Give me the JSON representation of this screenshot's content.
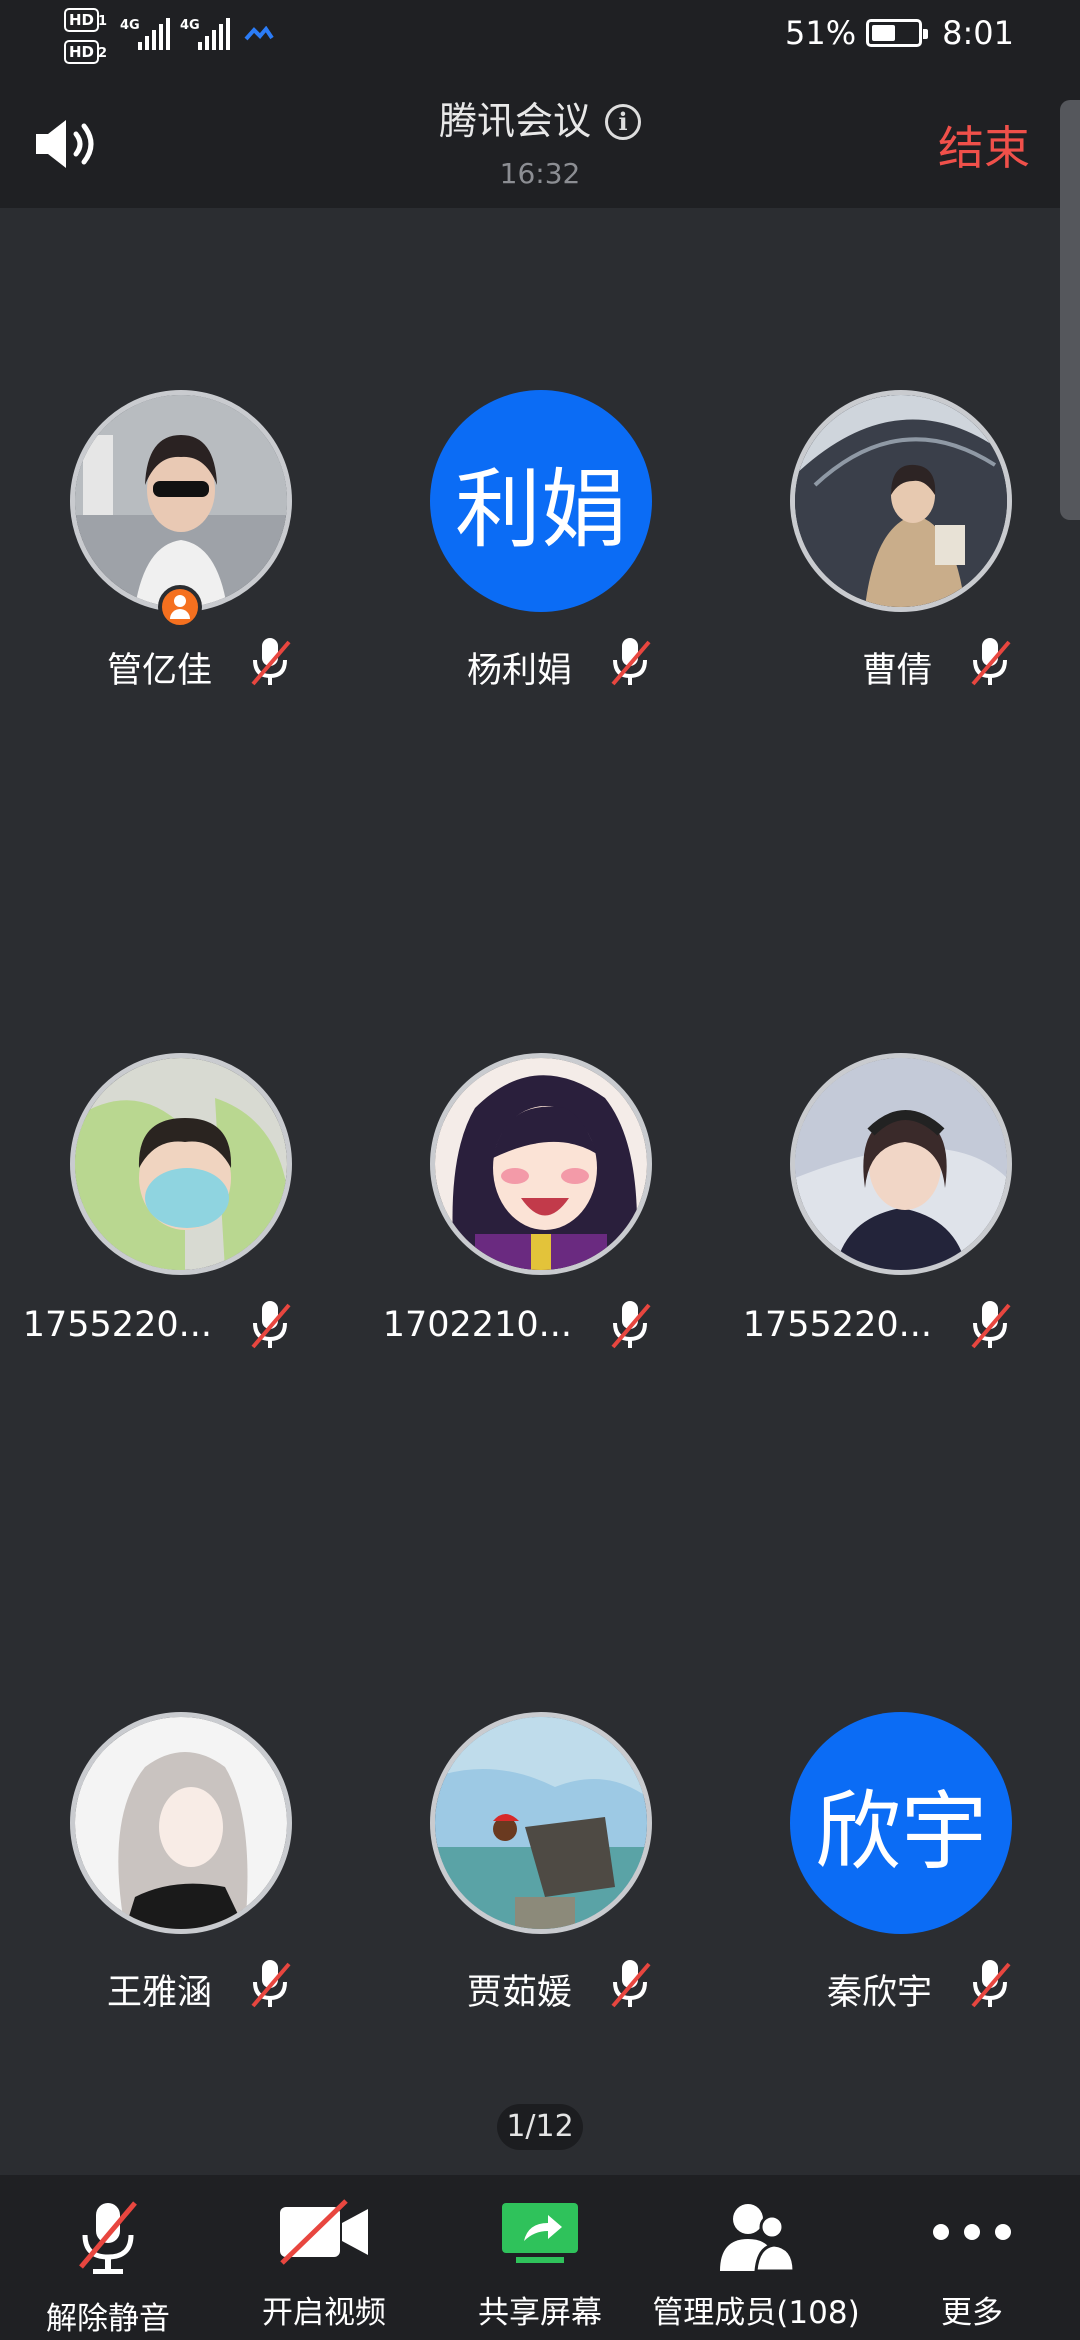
{
  "status_bar": {
    "hd1": "HD",
    "hd1_sub": "1",
    "hd2": "HD",
    "hd2_sub": "2",
    "network1": "4G",
    "network2": "4G",
    "battery_percent": "51%",
    "battery_level": 0.51,
    "time": "8:01"
  },
  "header": {
    "title": "腾讯会议",
    "timer": "16:32",
    "end_label": "结束"
  },
  "participants": [
    {
      "name": "管亿佳",
      "avatar_text": "",
      "host": true,
      "muted": true
    },
    {
      "name": "杨利娟",
      "avatar_text": "利娟",
      "host": false,
      "muted": true
    },
    {
      "name": "曹倩",
      "avatar_text": "",
      "host": false,
      "muted": true
    },
    {
      "name": "1755220...",
      "avatar_text": "",
      "host": false,
      "muted": true
    },
    {
      "name": "1702210...",
      "avatar_text": "",
      "host": false,
      "muted": true
    },
    {
      "name": "1755220...",
      "avatar_text": "",
      "host": false,
      "muted": true
    },
    {
      "name": "王雅涵",
      "avatar_text": "",
      "host": false,
      "muted": true
    },
    {
      "name": "贾茹媛",
      "avatar_text": "",
      "host": false,
      "muted": true
    },
    {
      "name": "秦欣宇",
      "avatar_text": "欣宇",
      "host": false,
      "muted": true
    }
  ],
  "pager": "1/12",
  "toolbar": {
    "unmute": "解除静音",
    "video": "开启视频",
    "share": "共享屏幕",
    "members": "管理成员(108)",
    "more": "更多"
  },
  "colors": {
    "end": "#f0504a",
    "avatar_blue": "#0b6cf5",
    "share_green": "#2fc25b",
    "mute_red": "#e8463f",
    "host_orange": "#f5701f"
  }
}
